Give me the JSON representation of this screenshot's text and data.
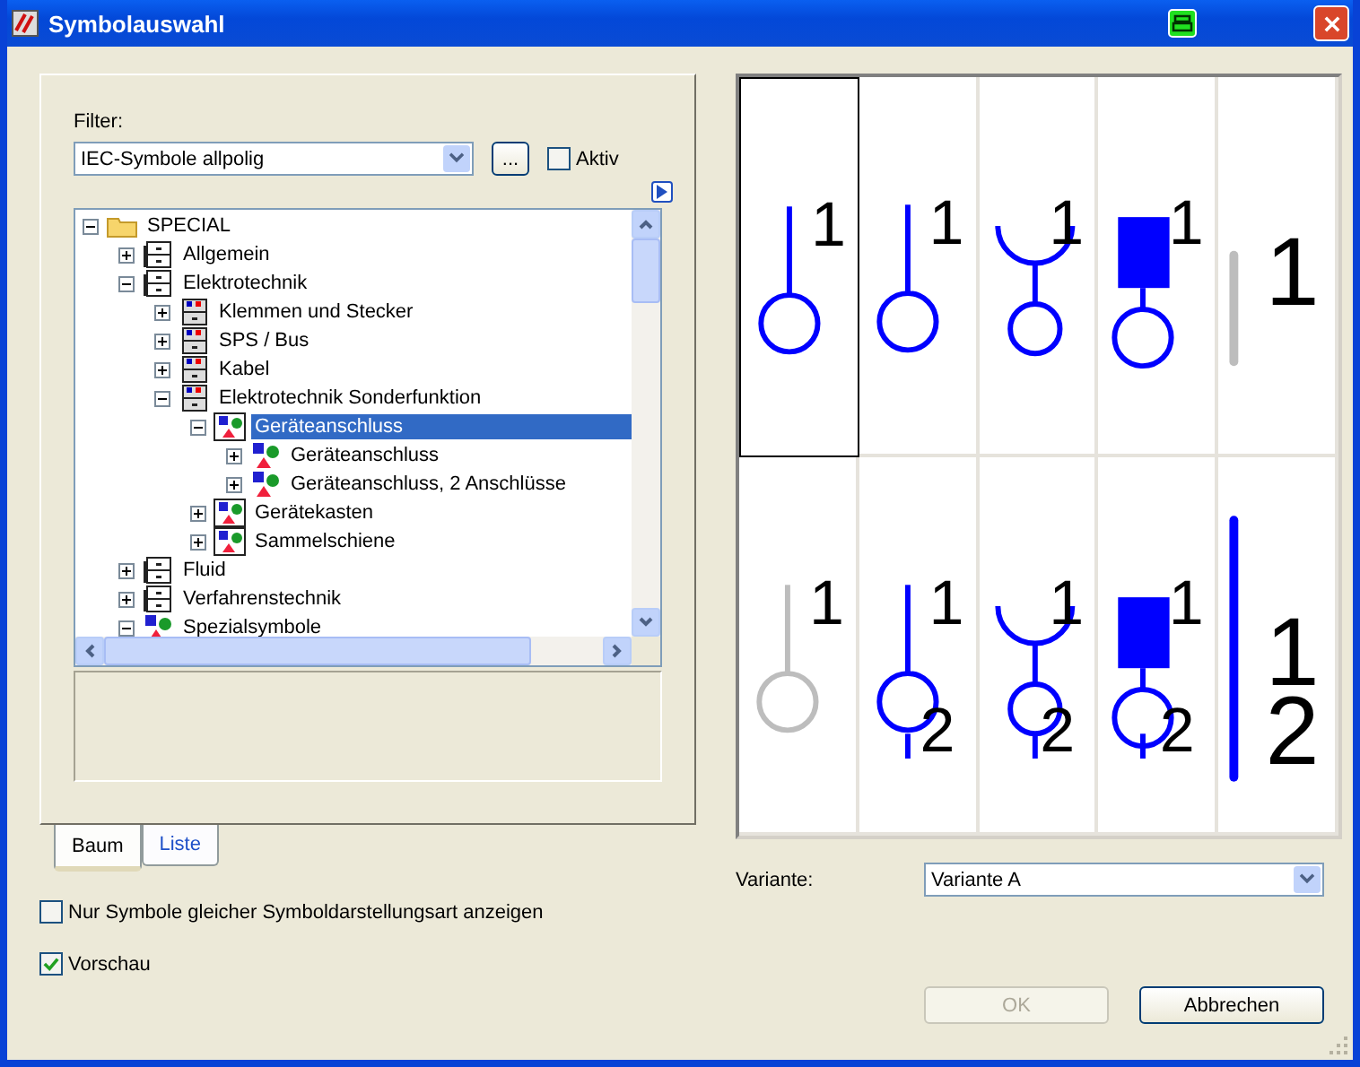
{
  "window": {
    "title": "Symbolauswahl"
  },
  "filter": {
    "label": "Filter:",
    "value": "IEC-Symbole allpolig",
    "browse_button": "...",
    "aktiv": {
      "label": "Aktiv",
      "checked": false
    }
  },
  "tree": [
    {
      "label": "SPECIAL",
      "kind": "folder",
      "expanded": true,
      "selected": false,
      "children": [
        {
          "label": "Allgemein",
          "kind": "drawer",
          "expanded": false,
          "selected": false
        },
        {
          "label": "Elektrotechnik",
          "kind": "drawer",
          "expanded": true,
          "selected": false,
          "children": [
            {
              "label": "Klemmen und Stecker",
              "kind": "drawer-colored",
              "expanded": false,
              "selected": false
            },
            {
              "label": "SPS / Bus",
              "kind": "drawer-colored",
              "expanded": false,
              "selected": false
            },
            {
              "label": "Kabel",
              "kind": "drawer-colored",
              "expanded": false,
              "selected": false
            },
            {
              "label": "Elektrotechnik Sonderfunktion",
              "kind": "drawer-colored",
              "expanded": true,
              "selected": false,
              "children": [
                {
                  "label": "Geräteanschluss",
                  "kind": "symbol-framed",
                  "expanded": true,
                  "selected": true,
                  "children": [
                    {
                      "label": "Geräteanschluss",
                      "kind": "symbol",
                      "expanded": false,
                      "selected": false
                    },
                    {
                      "label": "Geräteanschluss, 2 Anschlüsse",
                      "kind": "symbol",
                      "expanded": false,
                      "selected": false
                    }
                  ]
                },
                {
                  "label": "Gerätekasten",
                  "kind": "symbol-framed",
                  "expanded": false,
                  "selected": false
                },
                {
                  "label": "Sammelschiene",
                  "kind": "symbol-framed",
                  "expanded": false,
                  "selected": false
                }
              ]
            }
          ]
        },
        {
          "label": "Fluid",
          "kind": "drawer",
          "expanded": false,
          "selected": false
        },
        {
          "label": "Verfahrenstechnik",
          "kind": "drawer",
          "expanded": false,
          "selected": false
        },
        {
          "label": "Spezialsymbole",
          "kind": "symbol",
          "expanded": true,
          "selected": false
        }
      ]
    }
  ],
  "tabs": [
    {
      "label": "Baum",
      "selected": true
    },
    {
      "label": "Liste",
      "selected": false
    }
  ],
  "options": [
    {
      "label": "Nur Symbole gleicher Symboldarstellungsart anzeigen",
      "checked": false
    },
    {
      "label": "Vorschau",
      "checked": true
    }
  ],
  "preview": {
    "cells": [
      {
        "kind": "pin",
        "greyed": false,
        "selected": true,
        "labels": [
          "1"
        ]
      },
      {
        "kind": "pin",
        "greyed": false,
        "selected": false,
        "labels": [
          "1"
        ]
      },
      {
        "kind": "socket",
        "greyed": false,
        "selected": false,
        "labels": [
          "1"
        ]
      },
      {
        "kind": "block",
        "greyed": false,
        "selected": false,
        "labels": [
          "1"
        ]
      },
      {
        "kind": "bar",
        "greyed": true,
        "selected": false,
        "labels": [
          "1"
        ]
      },
      {
        "kind": "pin",
        "greyed": true,
        "selected": false,
        "labels": [
          "1"
        ]
      },
      {
        "kind": "pin",
        "greyed": false,
        "selected": false,
        "labels": [
          "1",
          "2"
        ]
      },
      {
        "kind": "socket",
        "greyed": false,
        "selected": false,
        "labels": [
          "1",
          "2"
        ]
      },
      {
        "kind": "block",
        "greyed": false,
        "selected": false,
        "labels": [
          "1",
          "2"
        ]
      },
      {
        "kind": "bar",
        "greyed": false,
        "selected": false,
        "labels": [
          "1",
          "2"
        ]
      }
    ]
  },
  "variant": {
    "label": "Variante:",
    "value": "Variante A"
  },
  "buttons": [
    {
      "label": "OK",
      "disabled": true
    },
    {
      "label": "Abbrechen",
      "disabled": false
    }
  ]
}
